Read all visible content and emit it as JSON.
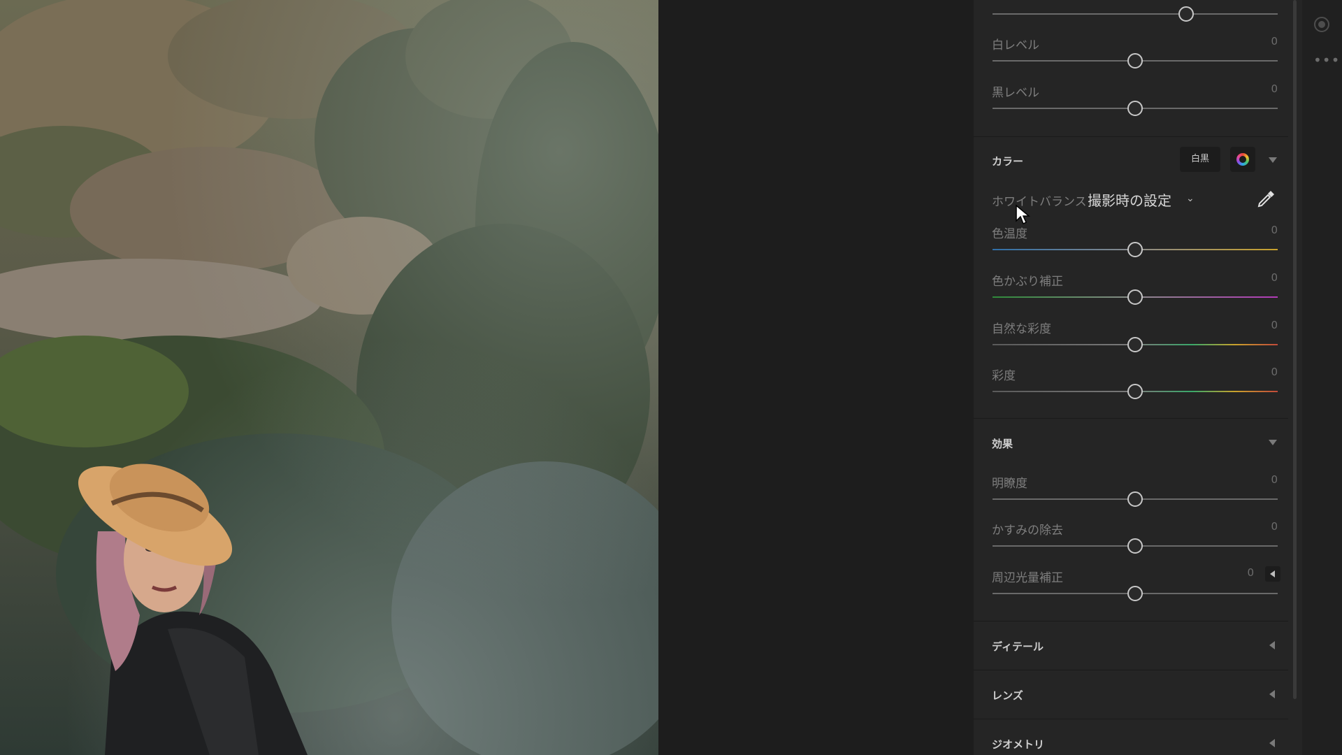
{
  "colors": {
    "panel_bg": "#252525",
    "canvas_bg": "#1d1d1d",
    "thumb_border": "#c8c8c8",
    "label": "#7e7e7e"
  },
  "light_sliders": [
    {
      "label": "",
      "value": "",
      "position": 0.68
    },
    {
      "label": "白レベル",
      "value": "0",
      "position": 0.5
    },
    {
      "label": "黒レベル",
      "value": "0",
      "position": 0.5
    }
  ],
  "color_section": {
    "title": "カラー",
    "bw_button": "白黒",
    "color_icon": "color-wheel-icon",
    "white_balance_label": "ホワイトバランス",
    "white_balance_value": "撮影時の設定",
    "sliders": [
      {
        "label": "色温度",
        "value": "0",
        "position": 0.5,
        "track": "temp"
      },
      {
        "label": "色かぶり補正",
        "value": "0",
        "position": 0.5,
        "track": "tint"
      },
      {
        "label": "自然な彩度",
        "value": "0",
        "position": 0.5,
        "track": "vib"
      },
      {
        "label": "彩度",
        "value": "0",
        "position": 0.5,
        "track": "sat"
      }
    ]
  },
  "effects_section": {
    "title": "効果",
    "sliders": [
      {
        "label": "明瞭度",
        "value": "0",
        "position": 0.5
      },
      {
        "label": "かすみの除去",
        "value": "0",
        "position": 0.5
      },
      {
        "label": "周辺光量補正",
        "value": "0",
        "position": 0.5
      }
    ]
  },
  "collapsed_sections": [
    {
      "title": "ディテール"
    },
    {
      "title": "レンズ"
    },
    {
      "title": "ジオメトリ"
    }
  ]
}
